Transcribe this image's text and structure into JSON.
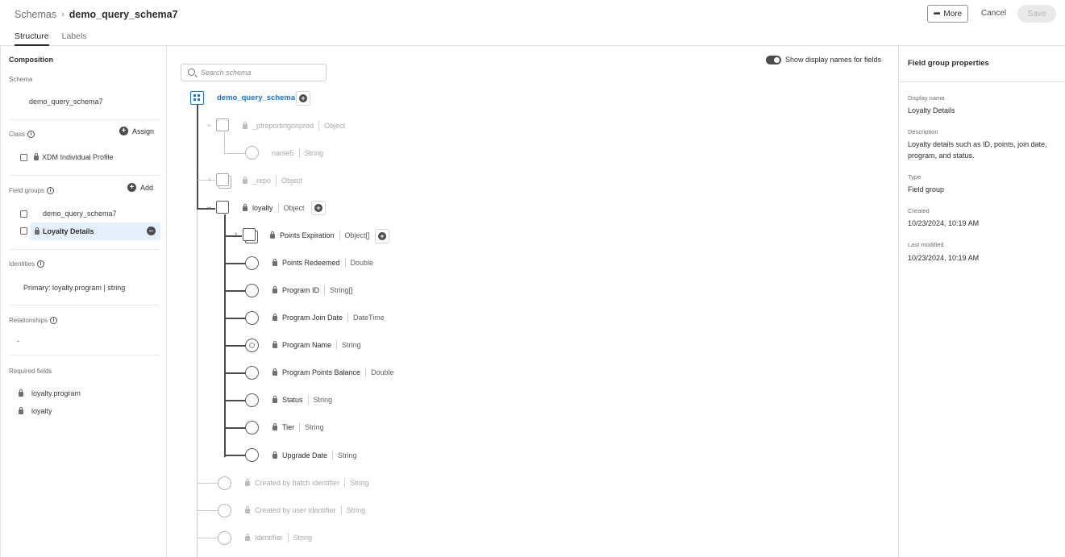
{
  "header": {
    "breadcrumb_parent": "Schemas",
    "breadcrumb_current": "demo_query_schema7",
    "tabs": [
      "Structure",
      "Labels"
    ],
    "more_label": "More",
    "cancel_label": "Cancel",
    "save_label": "Save"
  },
  "left": {
    "composition_title": "Composition",
    "schema_label": "Schema",
    "schema_name": "demo_query_schema7",
    "class_label": "Class",
    "assign_label": "Assign",
    "class_item": "XDM Individual Profile",
    "field_groups_label": "Field groups",
    "add_label": "Add",
    "field_groups": [
      "demo_query_schema7",
      "Loyalty Details"
    ],
    "identities_label": "Identities",
    "identity_value": "Primary: loyalty.program | string",
    "relationships_label": "Relationships",
    "relationships_value": "-",
    "required_fields_label": "Required fields",
    "required_fields": [
      "loyalty.program",
      "loyalty"
    ]
  },
  "canvas": {
    "search_placeholder": "Search schema",
    "toggle_label": "Show display names for fields",
    "root_name": "demo_query_schema7",
    "nodes": [
      {
        "name": "_pfreportingonprod",
        "type": "Object"
      },
      {
        "name": "name5",
        "type": "String"
      },
      {
        "name": "_repo",
        "type": "Object"
      },
      {
        "name": "loyalty",
        "type": "Object"
      },
      {
        "name": "Points Expiration",
        "type": "Object[]"
      },
      {
        "name": "Points Redeemed",
        "type": "Double"
      },
      {
        "name": "Program ID",
        "type": "String[]"
      },
      {
        "name": "Program Join Date",
        "type": "DateTime"
      },
      {
        "name": "Program Name",
        "type": "String"
      },
      {
        "name": "Program Points Balance",
        "type": "Double"
      },
      {
        "name": "Status",
        "type": "String"
      },
      {
        "name": "Tier",
        "type": "String"
      },
      {
        "name": "Upgrade Date",
        "type": "String"
      },
      {
        "name": "Created by batch identifier",
        "type": "String"
      },
      {
        "name": "Created by user identifier",
        "type": "String"
      },
      {
        "name": "Identifier",
        "type": "String"
      }
    ]
  },
  "right": {
    "title": "Field group properties",
    "display_name_label": "Display name",
    "display_name": "Loyalty Details",
    "description_label": "Description",
    "description": "Loyalty details such as ID, points, join date, program, and status.",
    "type_label": "Type",
    "type": "Field group",
    "created_label": "Created",
    "created": "10/23/2024, 10:19 AM",
    "modified_label": "Last modified",
    "modified": "10/23/2024, 10:19 AM"
  }
}
